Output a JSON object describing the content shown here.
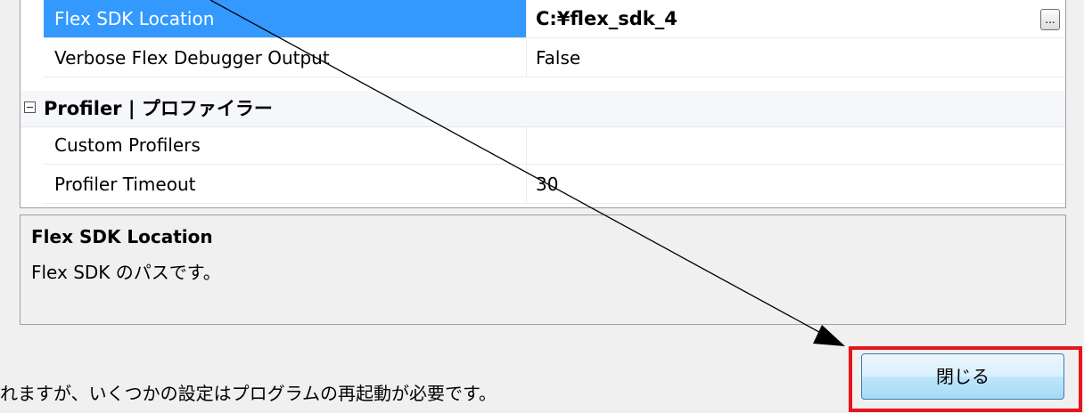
{
  "grid": {
    "rows": [
      {
        "label": "Flex SDK Location",
        "value": "C:¥flex_sdk_4",
        "ellipsis": "..."
      },
      {
        "label": "Verbose Flex Debugger Output",
        "value": "False"
      }
    ],
    "category": {
      "label": "Profiler | プロファイラー",
      "toggle_icon": "collapse-minus"
    },
    "category_rows": [
      {
        "label": "Custom Profilers",
        "value": ""
      },
      {
        "label": "Profiler Timeout",
        "value": "30"
      }
    ]
  },
  "description": {
    "title": "Flex SDK Location",
    "text": "Flex SDK のパスです。"
  },
  "status_text": "れますが、いくつかの設定はプログラムの再起動が必要です。",
  "close_button": {
    "label": "閉じる"
  },
  "annotation": {
    "highlight_color": "#e8141b",
    "arrow_color": "#000000"
  },
  "colors": {
    "selection": "#3399ff"
  }
}
